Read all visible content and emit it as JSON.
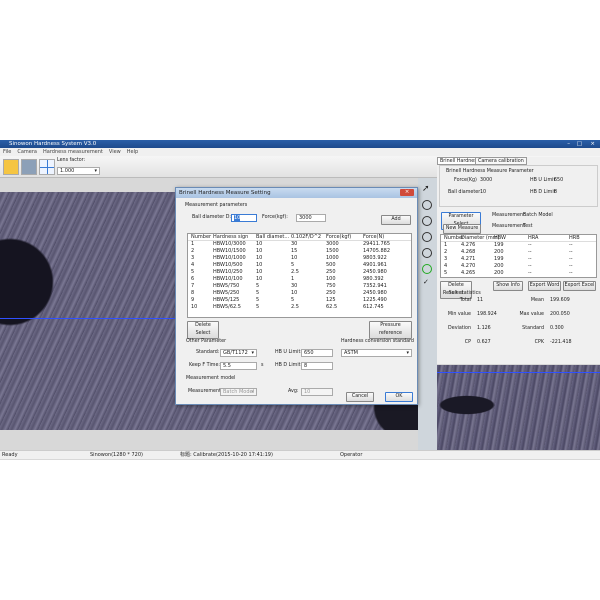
{
  "app": {
    "title": "Sinowon Hardness System V3.0",
    "menu": [
      "File",
      "Camera",
      "Hardness measurement",
      "View",
      "Help"
    ],
    "lens_label": "Lens factor:",
    "lens_value": "1.000"
  },
  "dialog": {
    "title": "Brinell Hardness Measure Setting",
    "close": "×",
    "params_label": "Measurement parameters",
    "ball_label": "Ball diameter D:",
    "ball_value": "10",
    "force_label": "Force(kgf):",
    "force_value": "3000",
    "add": "Add",
    "columns": [
      "Number",
      "Hardness sign",
      "Ball diamet...",
      "0.102F/D^2",
      "Force(kgf)",
      "Force(N)"
    ],
    "rows": [
      [
        "1",
        "HBW10/3000",
        "10",
        "30",
        "3000",
        "29411.765"
      ],
      [
        "2",
        "HBW10/1500",
        "10",
        "15",
        "1500",
        "14705.882"
      ],
      [
        "3",
        "HBW10/1000",
        "10",
        "10",
        "1000",
        "9803.922"
      ],
      [
        "4",
        "HBW10/500",
        "10",
        "5",
        "500",
        "4901.961"
      ],
      [
        "5",
        "HBW10/250",
        "10",
        "2.5",
        "250",
        "2450.980"
      ],
      [
        "6",
        "HBW10/100",
        "10",
        "1",
        "100",
        "980.392"
      ],
      [
        "7",
        "HBW5/750",
        "5",
        "30",
        "750",
        "7352.941"
      ],
      [
        "8",
        "HBW5/250",
        "5",
        "10",
        "250",
        "2450.980"
      ],
      [
        "9",
        "HBW5/125",
        "5",
        "5",
        "125",
        "1225.490"
      ],
      [
        "10",
        "HBW5/62.5",
        "5",
        "2.5",
        "62.5",
        "612.745"
      ]
    ],
    "delete_select": "Delete Select",
    "pressure_ref": "Pressure reference",
    "other_label": "Other Parameter",
    "standard_label": "Standard:",
    "standard_value": "GB/T1172",
    "keep_label": "Keep F Time:",
    "keep_value": "5.5",
    "keep_unit": "s",
    "hbu_label": "HB U Limit:",
    "hbu_value": "650",
    "hbd_label": "HB D Limit:",
    "hbd_value": "8",
    "conv_label": "Hardness conversion standard",
    "conv_value": "ASTM",
    "model_label": "Measurement model",
    "meas_label": "Measurement",
    "meas_value": "Batch Model",
    "avg_label": "Avg:",
    "avg_value": "10",
    "cancel": "Cancel",
    "ok": "OK"
  },
  "panel": {
    "tabs": [
      "Brinell Hardness",
      "Camera calibration"
    ],
    "group": "Brinell Hardness Measure Parameter",
    "force_label": "Force(Kg)",
    "force_value": "3000",
    "ball_label": "Ball diameter",
    "ball_value": "10",
    "hbu_label": "HB U Limit",
    "hbu_value": "650",
    "hbd_label": "HB D Limit",
    "hbd_value": "8",
    "param_select": "Parameter Select",
    "new_measure": "New Measure",
    "meas_label1": "Measurement",
    "meas_value1": "Batch Model",
    "meas_label2": "Measurement",
    "meas_value2": "Test",
    "columns": [
      "Number",
      "Diameter (mm)",
      "HBW",
      "HRA",
      "HRB"
    ],
    "rows": [
      [
        "1",
        "4.276",
        "199",
        "--",
        "--"
      ],
      [
        "2",
        "4.268",
        "200",
        "--",
        "--"
      ],
      [
        "3",
        "4.271",
        "199",
        "--",
        "--"
      ],
      [
        "4",
        "4.270",
        "200",
        "--",
        "--"
      ],
      [
        "5",
        "4.265",
        "200",
        "--",
        "--"
      ]
    ],
    "delete_select": "Delete Select",
    "show_info": "Show Info",
    "export_word": "Export Word",
    "export_excel": "Export Excel",
    "stats_label": "Result statistics",
    "stats": [
      [
        "Total",
        "11",
        "Mean",
        "199.609"
      ],
      [
        "Min value",
        "198.924",
        "Max value",
        "200.050"
      ],
      [
        "Deviation",
        "1.126",
        "Standard",
        "0.300"
      ],
      [
        "CP",
        "0.627",
        "CPK",
        "-221.418"
      ]
    ]
  },
  "status": {
    "ready": "Ready",
    "camera": "Sinowon(1280 * 720)",
    "calib": "标题: Calibrate(2015-10-20 17:41:19)",
    "operator": "Operator"
  },
  "colors": {
    "titlebar": "#1d4a8c",
    "crosshair": "#3050ff",
    "close": "#d04a3a"
  }
}
